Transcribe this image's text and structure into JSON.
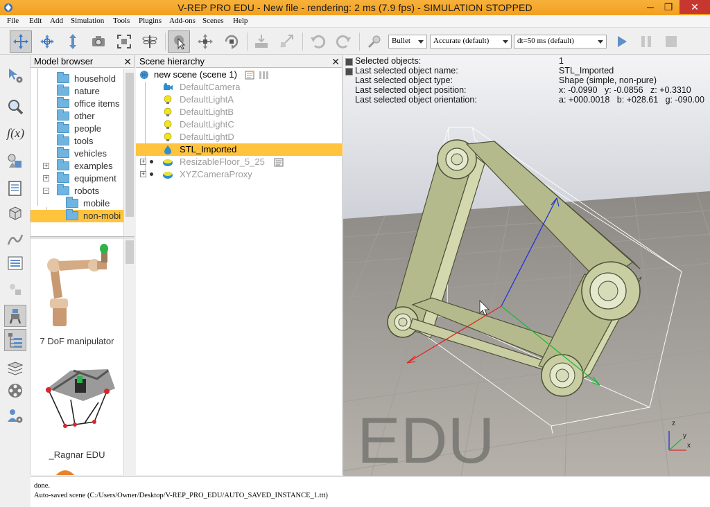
{
  "window": {
    "title": "V-REP PRO EDU - New file - rendering: 2 ms (7.9 fps) - SIMULATION STOPPED",
    "min_glyph": "─",
    "max_glyph": "❐",
    "close_glyph": "✕"
  },
  "menu": [
    "File",
    "Edit",
    "Add",
    "Simulation",
    "Tools",
    "Plugins",
    "Add-ons",
    "Scenes",
    "Help"
  ],
  "toolbar": {
    "engine": "Bullet",
    "accuracy": "Accurate (default)",
    "timestep": "dt=50 ms (default)"
  },
  "model_browser": {
    "title": "Model browser",
    "close_glyph": "✕",
    "tree": [
      {
        "label": "household"
      },
      {
        "label": "nature"
      },
      {
        "label": "office items"
      },
      {
        "label": "other"
      },
      {
        "label": "people"
      },
      {
        "label": "tools"
      },
      {
        "label": "vehicles"
      },
      {
        "label": "examples",
        "expander": "+"
      },
      {
        "label": "equipment",
        "expander": "+"
      },
      {
        "label": "robots",
        "expander": "−"
      },
      {
        "label": "mobile"
      },
      {
        "label": "non-mobi",
        "selected": true
      }
    ],
    "thumbnails": [
      {
        "label": "7 DoF manipulator"
      },
      {
        "label": "_Ragnar EDU"
      }
    ]
  },
  "scene_hierarchy": {
    "title": "Scene hierarchy",
    "close_glyph": "✕",
    "root": "new scene (scene 1)",
    "items": [
      {
        "label": "DefaultCamera",
        "icon": "camera-icon"
      },
      {
        "label": "DefaultLightA",
        "icon": "light-icon"
      },
      {
        "label": "DefaultLightB",
        "icon": "light-icon"
      },
      {
        "label": "DefaultLightC",
        "icon": "light-icon"
      },
      {
        "label": "DefaultLightD",
        "icon": "light-icon"
      },
      {
        "label": "STL_Imported",
        "icon": "shape-icon",
        "selected": true
      },
      {
        "label": "ResizableFloor_5_25",
        "icon": "floor-icon",
        "expander": "+"
      },
      {
        "label": "XYZCameraProxy",
        "icon": "proxy-icon",
        "expander": "+"
      }
    ]
  },
  "info": {
    "rows": [
      {
        "key": "Selected objects:",
        "value": "1"
      },
      {
        "key": "Last selected object name:",
        "value": "STL_Imported"
      },
      {
        "key": "Last selected object type:",
        "value": "Shape (simple, non-pure)"
      },
      {
        "key": "Last selected object position:",
        "value": "x: -0.0990   y: -0.0856   z: +0.3310"
      },
      {
        "key": "Last selected object orientation:",
        "value": "a: +000.0018   b: +028.61   g: -090.00"
      }
    ]
  },
  "viewport": {
    "watermark": "EDU",
    "axis_labels": {
      "x": "x",
      "y": "y",
      "z": "z"
    }
  },
  "console": {
    "lines": [
      "done.",
      "Auto-saved scene (C:/Users/Owner/Desktop/V-REP_PRO_EDU/AUTO_SAVED_INSTANCE_1.ttt)"
    ]
  },
  "colors": {
    "title_bar": "#f2a020",
    "selection": "#ffc33d",
    "close_button": "#c7372f",
    "folder": "#6fb5e0",
    "part": "#c3c99a"
  }
}
